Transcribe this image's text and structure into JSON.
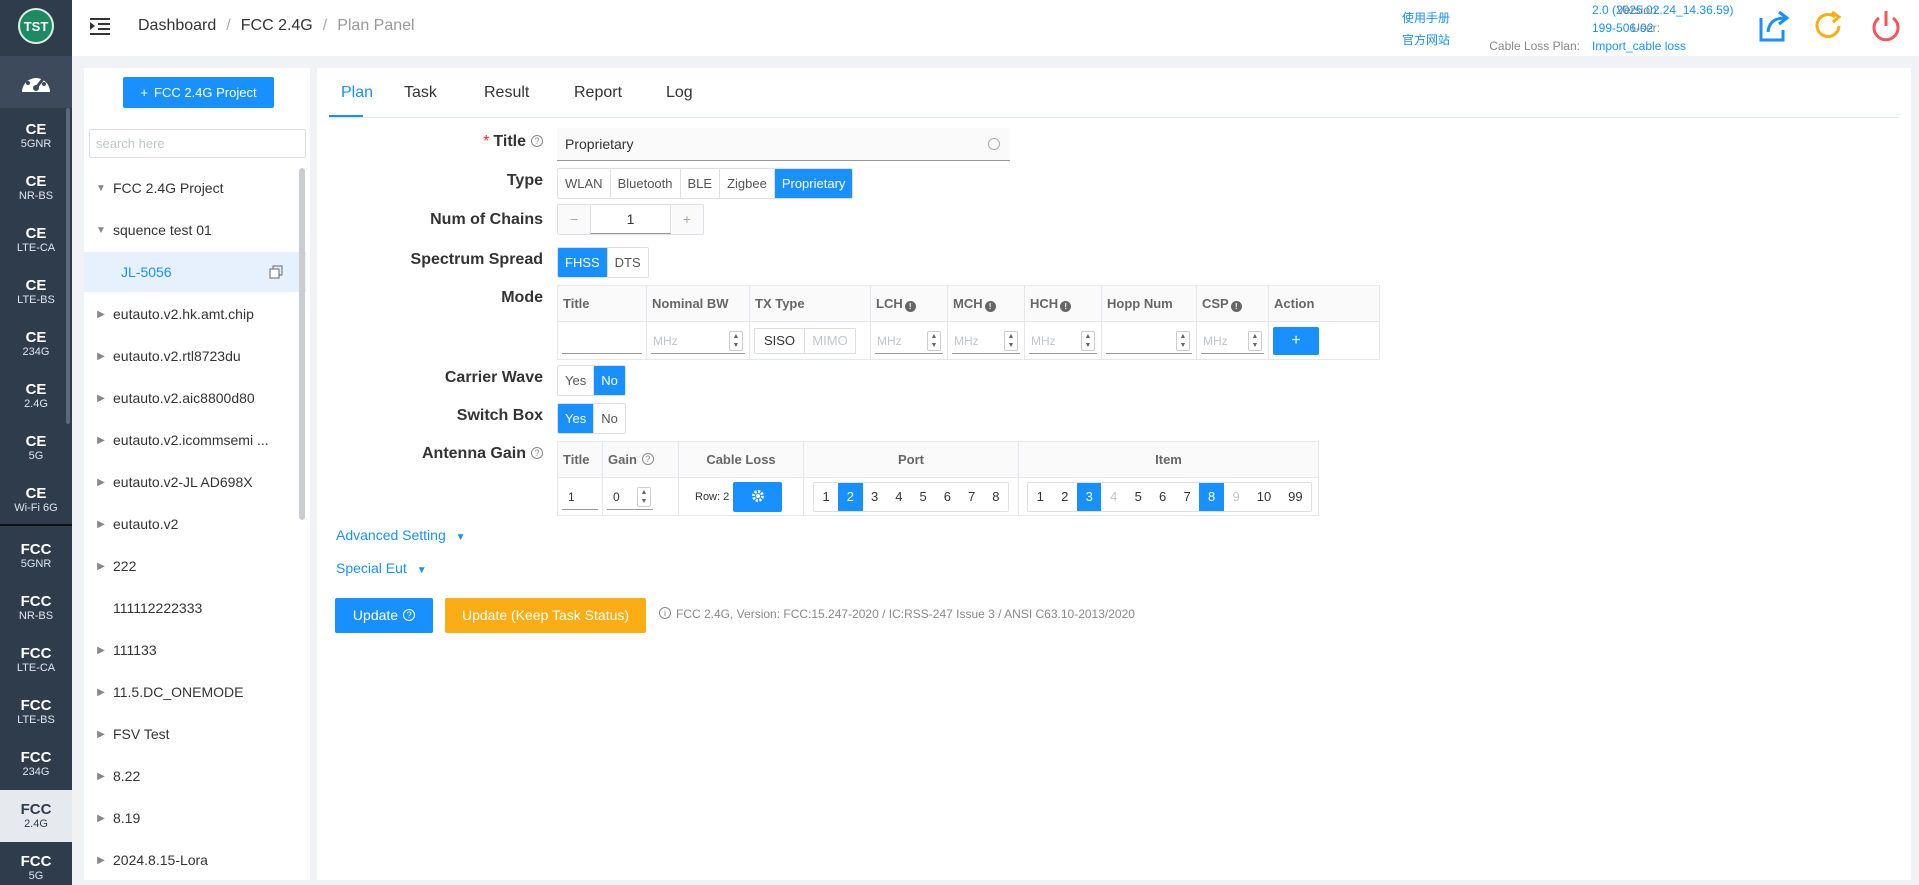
{
  "sidebar": {
    "logo": "TST",
    "items": [
      {
        "a": "CE",
        "b": "5GNR"
      },
      {
        "a": "CE",
        "b": "NR-BS"
      },
      {
        "a": "CE",
        "b": "LTE-CA"
      },
      {
        "a": "CE",
        "b": "LTE-BS"
      },
      {
        "a": "CE",
        "b": "234G"
      },
      {
        "a": "CE",
        "b": "2.4G"
      },
      {
        "a": "CE",
        "b": "5G"
      },
      {
        "a": "CE",
        "b": "Wi-Fi 6G"
      },
      {
        "a": "FCC",
        "b": "5GNR"
      },
      {
        "a": "FCC",
        "b": "NR-BS"
      },
      {
        "a": "FCC",
        "b": "LTE-CA"
      },
      {
        "a": "FCC",
        "b": "LTE-BS"
      },
      {
        "a": "FCC",
        "b": "234G"
      },
      {
        "a": "FCC",
        "b": "2.4G"
      },
      {
        "a": "FCC",
        "b": "5G"
      }
    ]
  },
  "header": {
    "breadcrumb": [
      "Dashboard",
      "FCC 2.4G",
      "Plan Panel"
    ],
    "links": [
      "使用手册",
      "官方网站"
    ],
    "meta_labels": [
      "Version:",
      "User:",
      "Cable Loss Plan:"
    ],
    "meta_values": [
      "2.0 (2025.02.24_14.36.59)",
      "199-506-02",
      "Import_cable loss"
    ]
  },
  "tree": {
    "project_button": "FCC 2.4G Project",
    "search_placeholder": "search here",
    "nodes": [
      {
        "label": "FCC 2.4G Project",
        "caret": "▼"
      },
      {
        "label": "squence test 01",
        "caret": "▼"
      },
      {
        "label": "JL-5056",
        "caret": ""
      },
      {
        "label": "eutauto.v2.hk.amt.chip",
        "caret": "▶"
      },
      {
        "label": "eutauto.v2.rtl8723du",
        "caret": "▶"
      },
      {
        "label": "eutauto.v2.aic8800d80",
        "caret": "▶"
      },
      {
        "label": "eutauto.v2.icommsemi ...",
        "caret": "▶"
      },
      {
        "label": "eutauto.v2-JL AD698X",
        "caret": "▶"
      },
      {
        "label": "eutauto.v2",
        "caret": "▶"
      },
      {
        "label": "222",
        "caret": "▶"
      },
      {
        "label": "111112222333",
        "caret": ""
      },
      {
        "label": "111133",
        "caret": "▶"
      },
      {
        "label": "11.5.DC_ONEMODE",
        "caret": "▶"
      },
      {
        "label": "FSV Test",
        "caret": "▶"
      },
      {
        "label": "8.22",
        "caret": "▶"
      },
      {
        "label": "8.19",
        "caret": "▶"
      },
      {
        "label": "2024.8.15-Lora",
        "caret": "▶"
      }
    ]
  },
  "tabs": [
    "Plan",
    "Task",
    "Result",
    "Report",
    "Log"
  ],
  "form": {
    "labels": {
      "title": "Title",
      "type": "Type",
      "chains": "Num of Chains",
      "spread": "Spectrum Spread",
      "mode": "Mode",
      "carrier": "Carrier Wave",
      "switch": "Switch Box",
      "antenna": "Antenna Gain"
    },
    "title_value": "Proprietary",
    "type_options": [
      "WLAN",
      "Bluetooth",
      "BLE",
      "Zigbee",
      "Proprietary"
    ],
    "type_selected": "Proprietary",
    "chains_value": "1",
    "chains_minus": "−",
    "chains_plus": "+",
    "spread_options": [
      "FHSS",
      "DTS"
    ],
    "spread_selected": "FHSS",
    "mode_headers": [
      "Title",
      "Nominal BW",
      "TX Type",
      "LCH",
      "MCH",
      "HCH",
      "Hopp Num",
      "CSP",
      "Action"
    ],
    "mode_info_mark": "!",
    "mode_placeholder": "MHz",
    "mode_tx": [
      "SISO",
      "MIMO"
    ],
    "mode_add": "+",
    "carrier_options": [
      "Yes",
      "No"
    ],
    "carrier_selected": "No",
    "switch_options": [
      "Yes",
      "No"
    ],
    "switch_selected": "Yes",
    "ant_headers": [
      "Title",
      "Gain",
      "Cable Loss",
      "Port",
      "Item"
    ],
    "ant_title": "1",
    "ant_gain": "0",
    "ant_row": "Row: 2",
    "ports": [
      "1",
      "2",
      "3",
      "4",
      "5",
      "6",
      "7",
      "8"
    ],
    "ports_selected": [
      "2"
    ],
    "items": [
      "1",
      "2",
      "3",
      "4",
      "5",
      "6",
      "7",
      "8",
      "9",
      "10",
      "99"
    ],
    "items_selected": [
      "3",
      "8"
    ],
    "items_disabled": [
      "4",
      "9"
    ],
    "advanced": "Advanced Setting",
    "special": "Special Eut",
    "update": "Update",
    "update_keep": "Update (Keep Task Status)",
    "note": "FCC 2.4G, Version: FCC:15.247-2020 / IC:RSS-247 Issue 3 / ANSI C63.10-2013/2020"
  },
  "colors": {
    "accent": "#1890ff",
    "warn": "#faad14",
    "sidebar": "#2f3c4c"
  }
}
